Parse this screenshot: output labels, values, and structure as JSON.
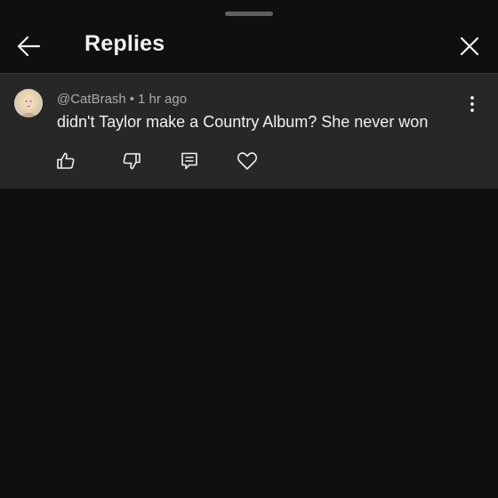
{
  "header": {
    "title": "Replies",
    "back_icon": "arrow-left-icon",
    "close_icon": "close-icon"
  },
  "comment": {
    "author": "@CatBrash",
    "separator": "•",
    "time": "1 hr ago",
    "text": "didn't Taylor make a Country Album? She never won",
    "more_icon": "more-vertical-icon",
    "actions": [
      {
        "name": "like",
        "icon": "thumbs-up-icon"
      },
      {
        "name": "dislike",
        "icon": "thumbs-down-icon"
      },
      {
        "name": "reply",
        "icon": "comment-reply-icon"
      },
      {
        "name": "heart",
        "icon": "heart-icon"
      }
    ]
  },
  "colors": {
    "background": "#0f0f0f",
    "comment_bg": "#272727",
    "text_primary": "#f1f1f1",
    "text_secondary": "#aaaaaa"
  }
}
